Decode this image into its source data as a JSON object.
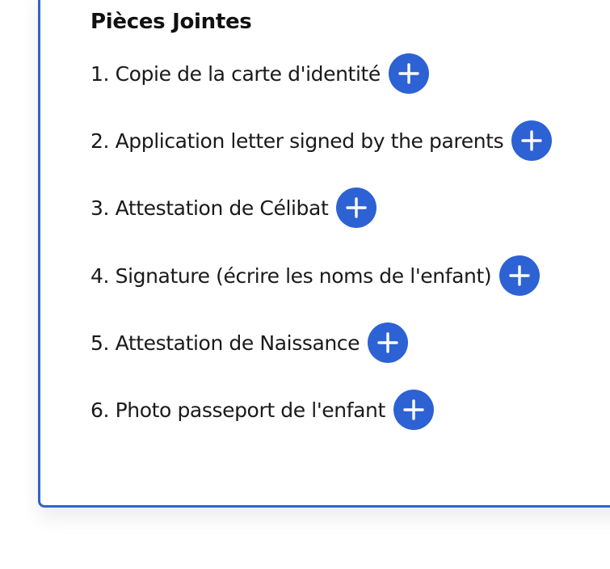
{
  "section": {
    "title": "Pièces Jointes"
  },
  "attachments": [
    {
      "label": "1. Copie de la carte d'identité",
      "icon": "plus-icon"
    },
    {
      "label": "2. Application letter signed by the parents",
      "icon": "plus-icon"
    },
    {
      "label": "3. Attestation de Célibat",
      "icon": "plus-icon"
    },
    {
      "label": "4. Signature (écrire les noms de l'enfant)",
      "icon": "plus-icon"
    },
    {
      "label": "5. Attestation de Naissance",
      "icon": "plus-icon"
    },
    {
      "label": "6. Photo passeport de l'enfant",
      "icon": "plus-icon"
    }
  ],
  "colors": {
    "accent": "#2d62d4",
    "border": "#3265c8"
  }
}
